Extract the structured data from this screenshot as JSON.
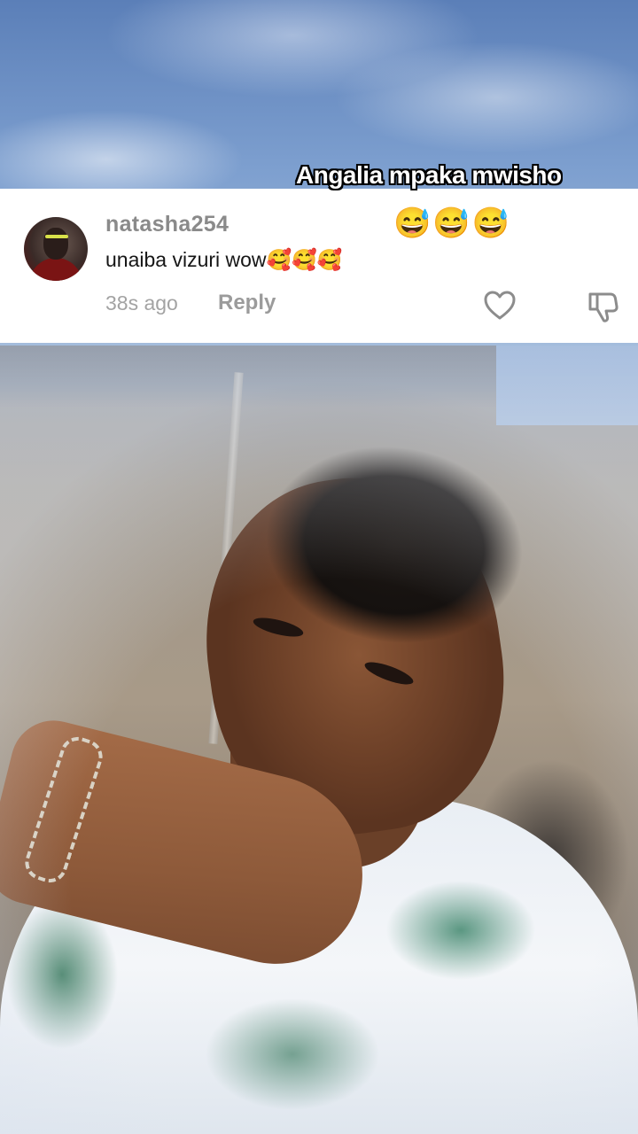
{
  "video": {
    "caption": "Angalia mpaka mwisho",
    "caption_emojis": "😅😅😅"
  },
  "comment": {
    "username": "natasha254",
    "text": "unaiba vizuri wow🥰🥰🥰",
    "timestamp": "38s ago",
    "reply_label": "Reply",
    "like_icon": "heart-outline-icon",
    "dislike_icon": "thumbs-down-outline-icon"
  },
  "colors": {
    "card_background": "#ffffff",
    "username": "#8a8a8a",
    "comment_text": "#161616",
    "meta_text": "#a3a3a3",
    "icon_stroke": "#8c8c8c"
  }
}
